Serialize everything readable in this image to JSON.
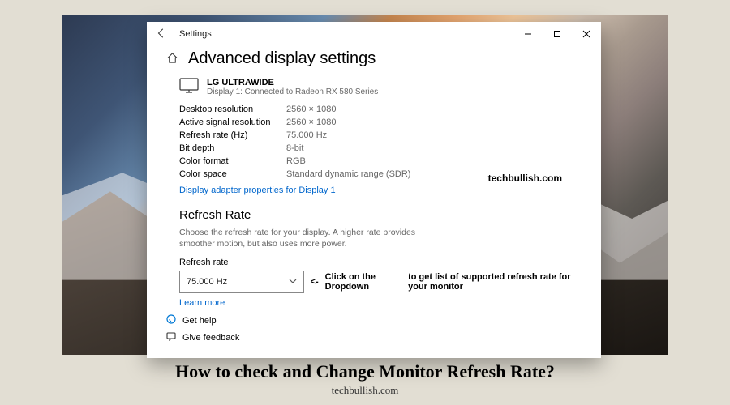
{
  "titlebar": {
    "app_name": "Settings"
  },
  "page": {
    "title": "Advanced display settings"
  },
  "display": {
    "name": "LG ULTRAWIDE",
    "subtitle": "Display 1: Connected to Radeon RX 580 Series"
  },
  "props": {
    "desktop_res_label": "Desktop resolution",
    "desktop_res_val": "2560 × 1080",
    "active_res_label": "Active signal resolution",
    "active_res_val": "2560 × 1080",
    "refresh_label": "Refresh rate (Hz)",
    "refresh_val": "75.000 Hz",
    "bitdepth_label": "Bit depth",
    "bitdepth_val": "8-bit",
    "colorfmt_label": "Color format",
    "colorfmt_val": "RGB",
    "colorspace_label": "Color space",
    "colorspace_val": "Standard dynamic range (SDR)"
  },
  "adapter_link": "Display adapter properties for Display 1",
  "refresh_section": {
    "title": "Refresh Rate",
    "desc": "Choose the refresh rate for your display. A higher rate provides smoother motion, but also uses more power.",
    "field_label": "Refresh rate",
    "selected": "75.000 Hz",
    "learn_more": "Learn more"
  },
  "annotation": {
    "arrow": "<-",
    "text_a": "Click on the Dropdown",
    "text_b": "to get list of supported refresh rate for your monitor"
  },
  "footer": {
    "help": "Get help",
    "feedback": "Give feedback"
  },
  "watermark": "techbullish.com",
  "article": {
    "title": "How to check and Change Monitor Refresh Rate?",
    "site": "techbullish.com"
  }
}
